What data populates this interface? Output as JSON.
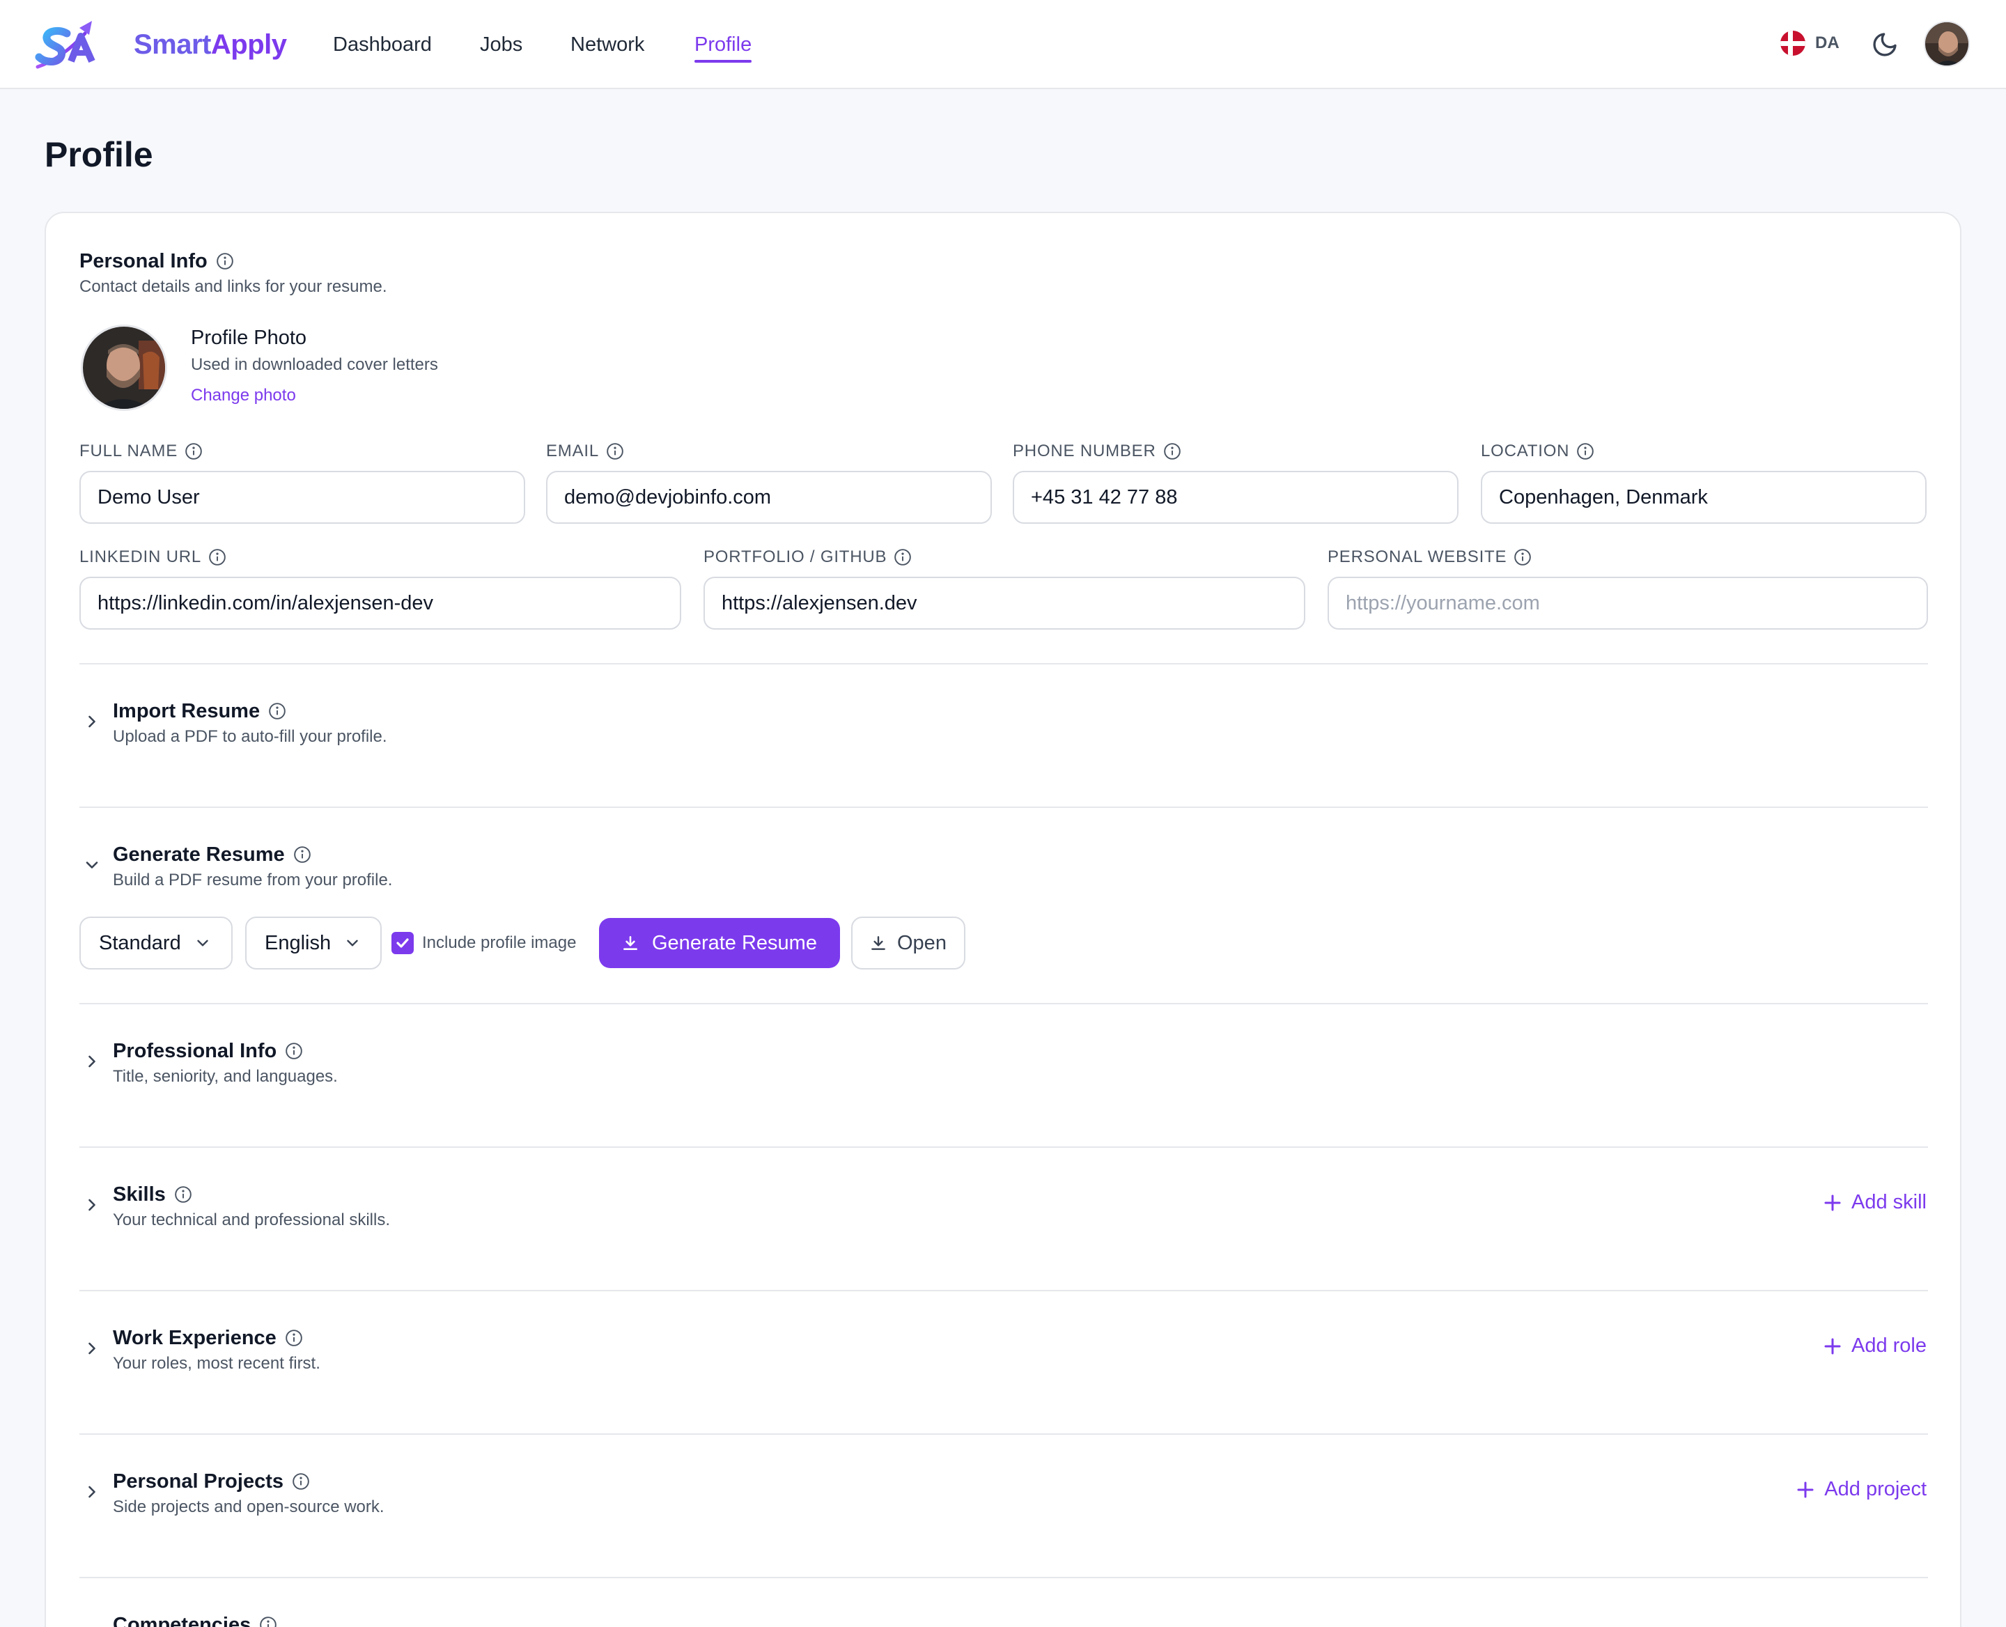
{
  "app": {
    "brand_part1": "Smart",
    "brand_part2": "Apply",
    "accent_color": "#7c3aed"
  },
  "nav": {
    "items": [
      {
        "label": "Dashboard"
      },
      {
        "label": "Jobs"
      },
      {
        "label": "Network"
      },
      {
        "label": "Profile",
        "active": true
      }
    ],
    "language": "DA",
    "theme_icon": "moon-icon"
  },
  "page": {
    "title": "Profile"
  },
  "personal_info": {
    "title": "Personal Info",
    "subtitle": "Contact details and links for your resume.",
    "photo_title": "Profile Photo",
    "photo_subtitle": "Used in downloaded cover letters",
    "change_photo": "Change photo",
    "fields": {
      "full_name": {
        "label": "FULL NAME",
        "value": "Demo User"
      },
      "email": {
        "label": "EMAIL",
        "value": "demo@devjobinfo.com"
      },
      "phone": {
        "label": "PHONE NUMBER",
        "value": "+45 31 42 77 88"
      },
      "location": {
        "label": "LOCATION",
        "value": "Copenhagen, Denmark"
      },
      "linkedin": {
        "label": "LINKEDIN URL",
        "value": "https://linkedin.com/in/alexjensen-dev"
      },
      "portfolio": {
        "label": "PORTFOLIO / GITHUB",
        "value": "https://alexjensen.dev"
      },
      "website": {
        "label": "PERSONAL WEBSITE",
        "value": "",
        "placeholder": "https://yourname.com"
      }
    }
  },
  "sections": {
    "import_resume": {
      "title": "Import Resume",
      "subtitle": "Upload a PDF to auto-fill your profile."
    },
    "generate_resume": {
      "title": "Generate Resume",
      "subtitle": "Build a PDF resume from your profile.",
      "template_select": "Standard",
      "language_select": "English",
      "include_image_label": "Include profile image",
      "include_image_checked": true,
      "generate_button": "Generate Resume",
      "open_button": "Open"
    },
    "professional_info": {
      "title": "Professional Info",
      "subtitle": "Title, seniority, and languages."
    },
    "skills": {
      "title": "Skills",
      "subtitle": "Your technical and professional skills.",
      "action": "Add skill"
    },
    "work_experience": {
      "title": "Work Experience",
      "subtitle": "Your roles, most recent first.",
      "action": "Add role"
    },
    "personal_projects": {
      "title": "Personal Projects",
      "subtitle": "Side projects and open-source work.",
      "action": "Add project"
    },
    "competencies": {
      "title": "Competencies"
    }
  }
}
